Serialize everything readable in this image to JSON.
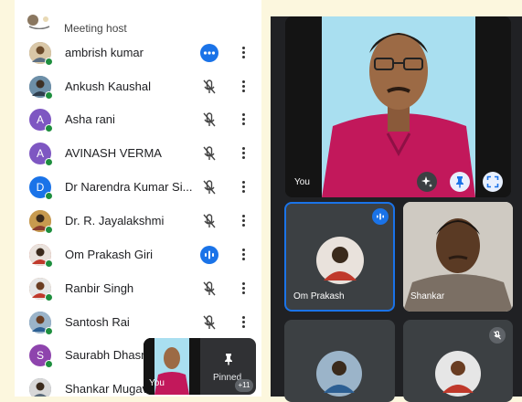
{
  "participants_panel": {
    "host_label": "Meeting host",
    "participants": [
      {
        "name": "ambrish kumar",
        "avatar": "photo",
        "avatar_color": "#8d7a63",
        "status": "more-options-active"
      },
      {
        "name": "Ankush Kaushal",
        "avatar": "photo",
        "avatar_color": "#4c6f8e",
        "status": "mic-off"
      },
      {
        "name": "Asha rani",
        "avatar": "A",
        "avatar_color": "#7e57c2",
        "status": "mic-off"
      },
      {
        "name": "AVINASH VERMA",
        "avatar": "A",
        "avatar_color": "#7e57c2",
        "status": "mic-off"
      },
      {
        "name": "Dr Narendra Kumar Si...",
        "avatar": "D",
        "avatar_color": "#1a73e8",
        "status": "mic-off"
      },
      {
        "name": "Dr. R. Jayalakshmi",
        "avatar": "photo",
        "avatar_color": "#b5833f",
        "status": "mic-off"
      },
      {
        "name": "Om Prakash Giri",
        "avatar": "photo",
        "avatar_color": "#c0392b",
        "status": "speaking"
      },
      {
        "name": "Ranbir Singh",
        "avatar": "photo",
        "avatar_color": "#b06b3a",
        "status": "mic-off"
      },
      {
        "name": "Santosh Rai",
        "avatar": "photo",
        "avatar_color": "#2c5f93",
        "status": "mic-off"
      },
      {
        "name": "Saurabh Dhasm",
        "avatar": "S",
        "avatar_color": "#8e44ad",
        "status": "none"
      },
      {
        "name": "Shankar Mugav",
        "avatar": "photo",
        "avatar_color": "#5b6b7a",
        "status": "none"
      }
    ]
  },
  "meeting": {
    "self_tile_label": "You",
    "tile_om_label": "Om Prakash",
    "tile_shankar_label": "Shankar",
    "pip_self_label": "You",
    "pip_pinned_label": "Pinned",
    "pip_more_count": "+11"
  },
  "colors": {
    "accent_blue": "#1a73e8",
    "speaking_badge": "#1a73e8",
    "meet_bg": "#202124",
    "panel_bg": "#ffffff",
    "page_bg": "#fcf7de"
  }
}
